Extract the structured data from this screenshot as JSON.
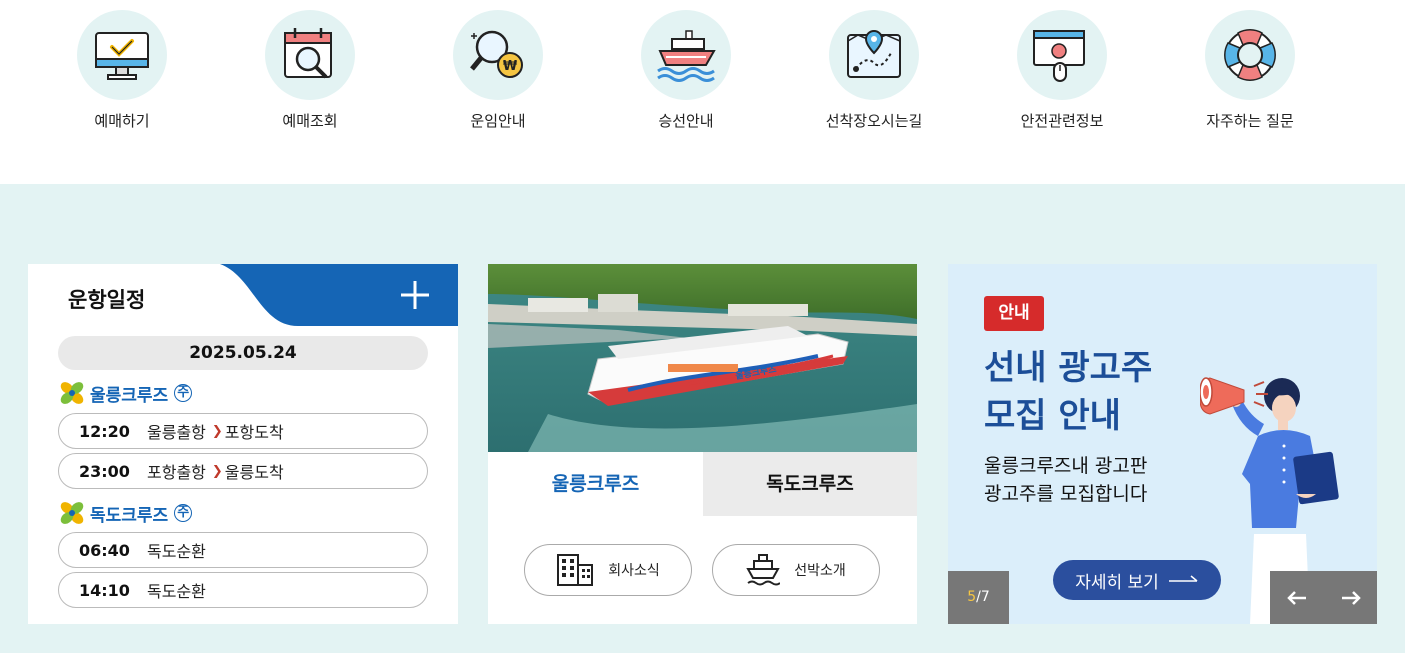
{
  "quick_menu": {
    "items": [
      {
        "label": "예매하기",
        "icon": "monitor-check-icon"
      },
      {
        "label": "예매조회",
        "icon": "calendar-search-icon"
      },
      {
        "label": "운임안내",
        "icon": "fare-search-icon"
      },
      {
        "label": "승선안내",
        "icon": "ship-icon"
      },
      {
        "label": "선착장오시는길",
        "icon": "map-route-icon"
      },
      {
        "label": "안전관련정보",
        "icon": "safety-screen-icon"
      },
      {
        "label": "자주하는 질문",
        "icon": "lifebuoy-icon"
      }
    ]
  },
  "schedule": {
    "title": "운항일정",
    "date": "2025.05.24",
    "routes": [
      {
        "name": "울릉크루즈",
        "badge": "주",
        "trips": [
          {
            "time": "12:20",
            "from": "울릉출항",
            "to": "포항도착"
          },
          {
            "time": "23:00",
            "from": "포항출항",
            "to": "울릉도착"
          }
        ]
      },
      {
        "name": "독도크루즈",
        "badge": "주",
        "trips": [
          {
            "time": "06:40",
            "from": "독도순환",
            "to": ""
          },
          {
            "time": "14:10",
            "from": "독도순환",
            "to": ""
          }
        ]
      }
    ]
  },
  "cruise": {
    "ship_name": "울릉크루즈",
    "tabs": [
      {
        "label": "울릉크루즈",
        "active": true
      },
      {
        "label": "독도크루즈",
        "active": false
      }
    ],
    "buttons": [
      {
        "label": "회사소식",
        "icon": "building-icon"
      },
      {
        "label": "선박소개",
        "icon": "ship-icon"
      }
    ]
  },
  "banner": {
    "badge": "안내",
    "title_line1": "선내 광고주",
    "title_line2": "모집 안내",
    "desc_line1": "울릉크루즈내 광고판",
    "desc_line2": "광고주를 모집합니다",
    "more_label": "자세히 보기",
    "page_current": "5",
    "page_sep": "/",
    "page_total": "7"
  },
  "colors": {
    "accent_blue": "#1565b5",
    "bg_mint": "#e3f3f3",
    "badge_red": "#d62b2b",
    "banner_bg": "#dbeefa",
    "banner_title": "#1c4e98"
  }
}
